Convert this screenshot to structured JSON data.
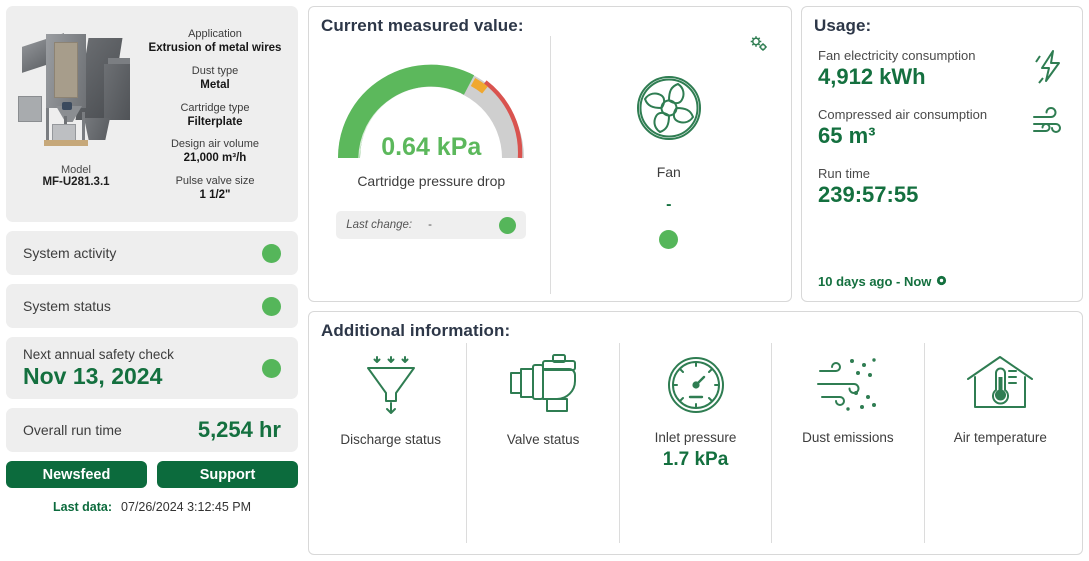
{
  "machine": {
    "image_alt": "dust-collector-render",
    "model_label": "Model",
    "model_value": "MF-U281.3.1",
    "specs": [
      {
        "label": "Application",
        "value": "Extrusion of metal wires"
      },
      {
        "label": "Dust type",
        "value": "Metal"
      },
      {
        "label": "Cartridge type",
        "value": "Filterplate"
      },
      {
        "label": "Design air volume",
        "value": "21,000 m³/h"
      },
      {
        "label": "Pulse valve size",
        "value": "1 1/2\""
      }
    ]
  },
  "status_rows": [
    {
      "label": "System activity",
      "state": "green"
    },
    {
      "label": "System status",
      "state": "green"
    }
  ],
  "safety": {
    "label": "Next annual safety check",
    "date": "Nov 13, 2024",
    "state": "green"
  },
  "runtime": {
    "label": "Overall run time",
    "value": "5,254 hr"
  },
  "buttons": {
    "newsfeed": "Newsfeed",
    "support": "Support"
  },
  "last_data": {
    "label": "Last data:",
    "value": "07/26/2024 3:12:45 PM"
  },
  "measured": {
    "title": "Current measured value:",
    "gauge": {
      "value": "0.64 kPa",
      "caption": "Cartridge pressure drop",
      "fill_percent": 60,
      "warn_percent": 64,
      "track_color": "#cfcfcf",
      "fill_color": "#5cb85c",
      "warn_color": "#f0a830",
      "alarm_color": "#d9534f"
    },
    "last_change": {
      "label": "Last change:",
      "value": "-",
      "state": "green"
    },
    "fan": {
      "label": "Fan",
      "value": "-",
      "state": "green"
    }
  },
  "usage": {
    "title": "Usage:",
    "items": [
      {
        "label": "Fan electricity consumption",
        "value": "4,912 kWh",
        "icon": "lightning-bolt-icon"
      },
      {
        "label": "Compressed air consumption",
        "value": "65 m³",
        "icon": "wind-icon"
      },
      {
        "label": "Run time",
        "value": "239:57:55",
        "icon": "none"
      }
    ],
    "footer": "10 days ago - Now"
  },
  "additional": {
    "title": "Additional information:",
    "items": [
      {
        "label": "Discharge status",
        "value": "",
        "state": "green",
        "icon": "funnel-discharge-icon"
      },
      {
        "label": "Valve status",
        "value": "",
        "state": "grey",
        "icon": "solenoid-valve-icon"
      },
      {
        "label": "Inlet pressure",
        "value": "1.7 kPa",
        "state": "green",
        "icon": "pressure-gauge-icon"
      },
      {
        "label": "Dust emissions",
        "value": "",
        "state": "green",
        "icon": "dust-wind-icon"
      },
      {
        "label": "Air temperature",
        "value": "",
        "state": "grey",
        "icon": "house-thermometer-icon"
      }
    ]
  },
  "colors": {
    "brand_green": "#14703f",
    "button_green": "#0c6b3d",
    "status_green": "#55b65a",
    "status_grey": "#c4c4c4",
    "heading": "#2d3748"
  }
}
